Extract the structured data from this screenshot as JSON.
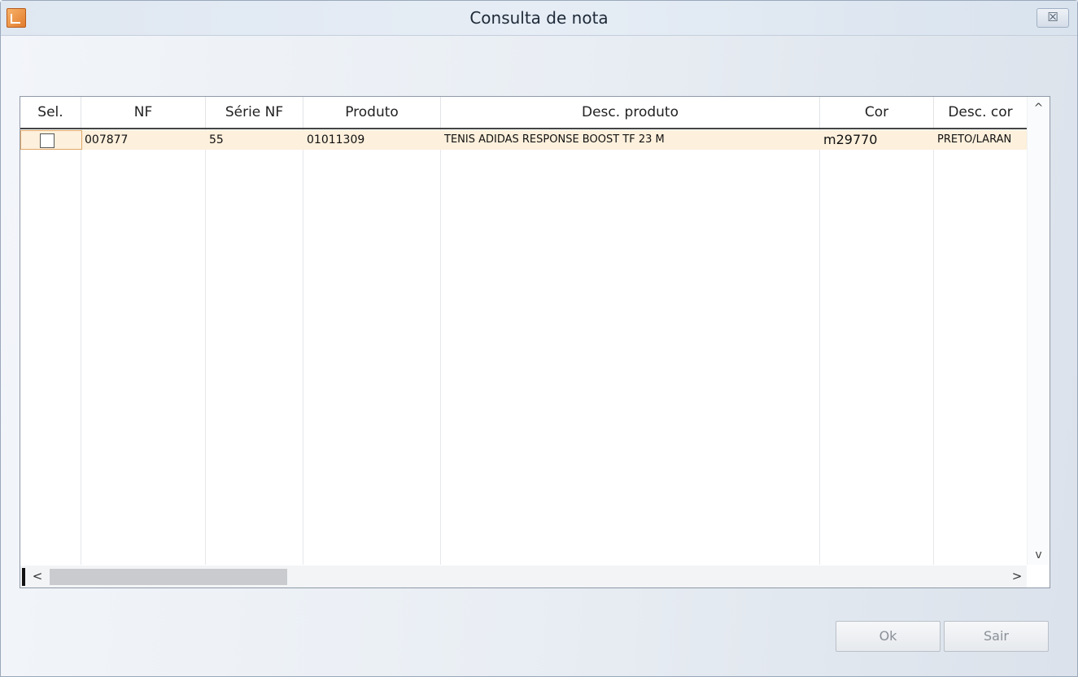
{
  "window": {
    "title": "Consulta de nota",
    "close_symbol": "☒"
  },
  "grid": {
    "columns": [
      "Sel.",
      "NF",
      "Série NF",
      "Produto",
      "Desc. produto",
      "Cor",
      "Desc. cor"
    ],
    "rows": [
      {
        "selected": false,
        "nf": "007877",
        "serie_nf": "55",
        "produto": "01011309",
        "desc_produto": "TENIS ADIDAS RESPONSE BOOST TF 23 M",
        "cor": "m29770",
        "desc_cor": "PRETO/LARAN"
      }
    ],
    "row_highlight_color": "#fdf0dc"
  },
  "scroll": {
    "up": "^",
    "down": "v",
    "left": "<",
    "right": ">"
  },
  "buttons": {
    "ok": "Ok",
    "sair": "Sair"
  }
}
